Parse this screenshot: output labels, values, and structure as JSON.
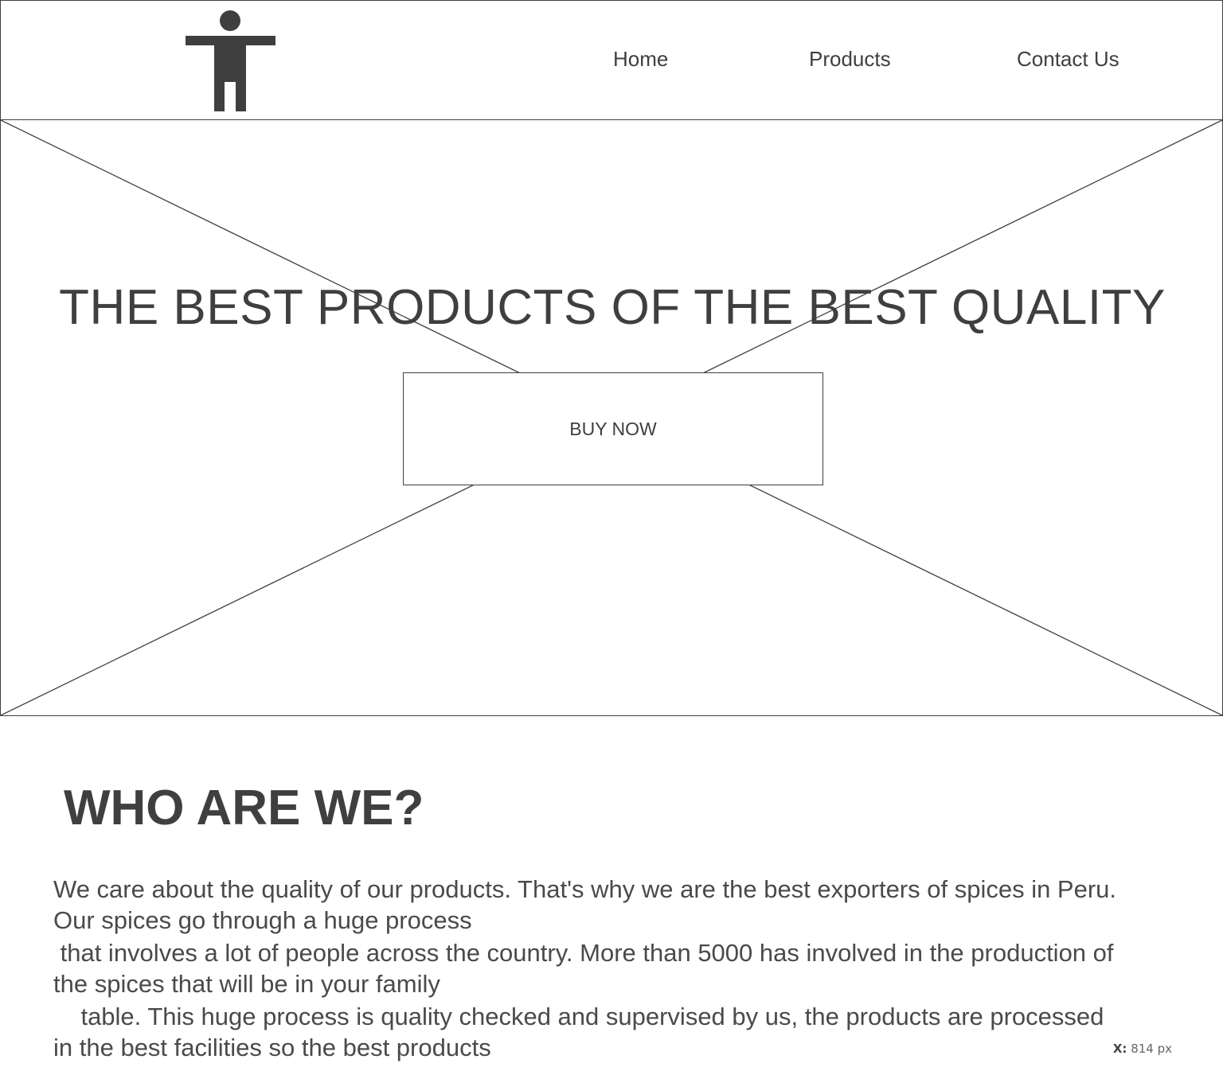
{
  "header": {
    "logo_icon": "person-arms-out-icon",
    "nav": [
      {
        "label": "Home"
      },
      {
        "label": "Products"
      },
      {
        "label": "Contact Us"
      }
    ]
  },
  "hero": {
    "image_placeholder_icon": "image-placeholder-x-icon",
    "title": "THE BEST PRODUCTS OF THE BEST QUALITY",
    "button_label": "BUY NOW"
  },
  "about": {
    "title": "WHO ARE WE?",
    "lines": [
      "We care about the quality of our products. That's why we are the best exporters of spices in Peru.",
      "Our spices go through a huge process",
      " that involves a lot of people across the country. More than 5000 has involved in the production of",
      "the spices that will be in your family",
      "    table. This huge process is quality checked and supervised by us, the products are processed",
      "in the best facilities so the best products"
    ]
  },
  "coordinate_readout": {
    "label": "X:",
    "value": "814 px"
  },
  "colors": {
    "stroke": "#3f3f3f",
    "background": "#ffffff"
  }
}
